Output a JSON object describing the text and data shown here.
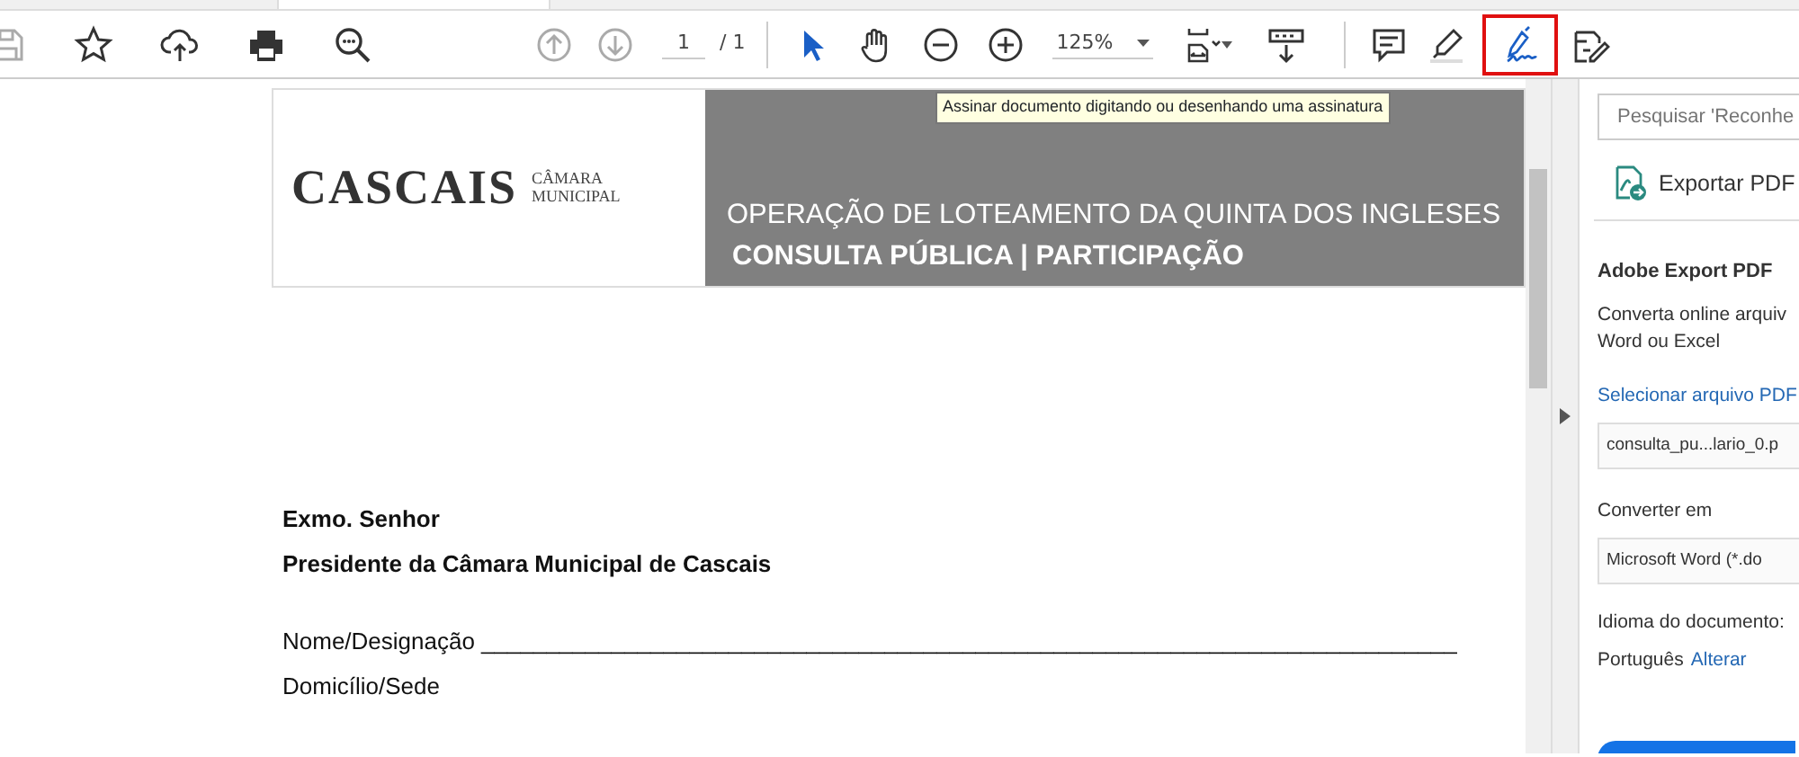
{
  "toolbar": {
    "tools": [
      {
        "kind": "save",
        "disabled": true,
        "selected": false
      },
      {
        "kind": "star",
        "disabled": false,
        "selected": false
      },
      {
        "kind": "upload",
        "disabled": false,
        "selected": false
      },
      {
        "kind": "print",
        "disabled": false,
        "selected": false
      },
      {
        "kind": "find",
        "disabled": false,
        "selected": false
      },
      {
        "kind": "prev",
        "disabled": true,
        "selected": false
      },
      {
        "kind": "next",
        "disabled": true,
        "selected": false
      },
      {
        "kind": "page"
      },
      {
        "kind": "sep"
      },
      {
        "kind": "pointer",
        "disabled": false,
        "selected": true
      },
      {
        "kind": "hand",
        "disabled": false,
        "selected": false
      },
      {
        "kind": "zoomout",
        "disabled": false,
        "selected": false
      },
      {
        "kind": "zoomin",
        "disabled": false,
        "selected": false
      },
      {
        "kind": "zoom"
      },
      {
        "kind": "fit",
        "disabled": false,
        "selected": false
      },
      {
        "kind": "scroll",
        "disabled": false,
        "selected": false
      },
      {
        "kind": "sep"
      },
      {
        "kind": "comment",
        "disabled": false,
        "selected": false
      },
      {
        "kind": "highlight",
        "disabled": false,
        "selected": false
      },
      {
        "kind": "sign",
        "disabled": false,
        "selected": true
      },
      {
        "kind": "fillsign",
        "disabled": false,
        "selected": false
      }
    ],
    "page_value": "1",
    "page_total": "/ 1",
    "zoom_value": "125%",
    "tooltip": "Assinar documento digitando ou desenhando uma assinatura"
  },
  "document": {
    "logo": "CASCAIS",
    "logo_sub_1": "CÂMARA",
    "logo_sub_2": "MUNICIPAL",
    "banner_title": "OPERAÇÃO DE LOTEAMENTO DA QUINTA DOS INGLESES",
    "banner_subtitle": "CONSULTA PÚBLICA | PARTICIPAÇÃO",
    "paragraphs": [
      {
        "kind": "bold",
        "text": "Exmo. Senhor"
      },
      {
        "kind": "bold",
        "text": "Presidente da Câmara Municipal de Cascais"
      },
      {
        "kind": "gap"
      },
      {
        "kind": "plain",
        "text": "Nome/Designação ___________________________________________________________________________"
      },
      {
        "kind": "plain",
        "text": "Domicílio/Sede"
      }
    ]
  },
  "side_panel": {
    "search_placeholder": "Pesquisar 'Reconhe",
    "tool_label": "Exportar PDF",
    "heading": "Adobe Export PDF",
    "description_1": "Converta online arquiv",
    "description_2": "Word ou Excel",
    "select_link": "Selecionar arquivo PDF",
    "file_value": "consulta_pu...lario_0.p",
    "convert_label": "Converter em",
    "convert_value": "Microsoft Word (*.do",
    "language_label": "Idioma do documento:",
    "language_value": "Português",
    "change_link": "Alterar"
  }
}
